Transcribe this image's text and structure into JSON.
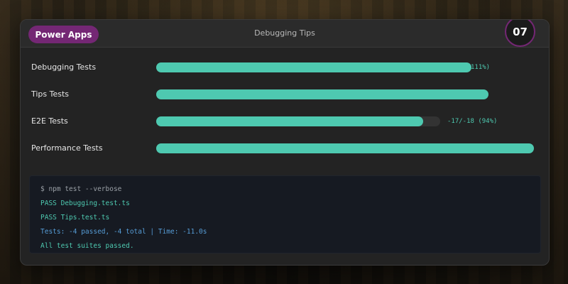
{
  "app": {
    "badge": "Power Apps",
    "title": "Debugging Tips",
    "slide_number": "07"
  },
  "colors": {
    "accent": "#742774",
    "bar": "#4ec9b0",
    "card": "#232323",
    "terminal": "#161a22"
  },
  "tests": [
    {
      "label": "Debugging Tests",
      "progress": 1.11,
      "percent_text": "111%)"
    },
    {
      "label": "Tips Tests",
      "progress": 1.17,
      "percent_text": ""
    },
    {
      "label": "E2E Tests",
      "progress": 0.94,
      "percent_text": "-17/-18 (94%)"
    },
    {
      "label": "Performance Tests",
      "progress": 1.33,
      "percent_text": ""
    }
  ],
  "terminal": {
    "lines": [
      {
        "text": "$ npm test --verbose",
        "kind": "cmd"
      },
      {
        "text": "PASS Debugging.test.ts",
        "kind": "pass"
      },
      {
        "text": "PASS Tips.test.ts",
        "kind": "pass"
      },
      {
        "text": "Tests: -4 passed, -4 total | Time: -11.0s",
        "kind": "info"
      },
      {
        "text": "All test suites passed.",
        "kind": "pass"
      }
    ]
  }
}
